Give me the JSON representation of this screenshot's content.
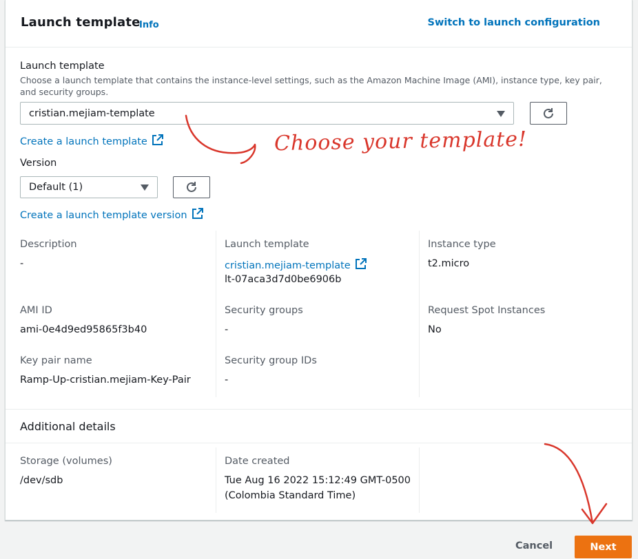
{
  "header": {
    "title": "Launch template",
    "info": "Info",
    "switch_link": "Switch to launch configuration"
  },
  "template_field": {
    "label": "Launch template",
    "description": "Choose a launch template that contains the instance-level settings, such as the Amazon Machine Image (AMI), instance type, key pair, and security groups.",
    "selected": "cristian.mejiam-template",
    "create_link": "Create a launch template"
  },
  "version_field": {
    "label": "Version",
    "selected": "Default (1)",
    "create_link": "Create a launch template version"
  },
  "details": {
    "description_label": "Description",
    "description_value": "-",
    "launch_template_label": "Launch template",
    "launch_template_link": "cristian.mejiam-template",
    "launch_template_id": "lt-07aca3d7d0be6906b",
    "instance_type_label": "Instance type",
    "instance_type_value": "t2.micro",
    "ami_label": "AMI ID",
    "ami_value": "ami-0e4d9ed95865f3b40",
    "security_groups_label": "Security groups",
    "security_groups_value": "-",
    "spot_label": "Request Spot Instances",
    "spot_value": "No",
    "key_pair_label": "Key pair name",
    "key_pair_value": "Ramp-Up-cristian.mejiam-Key-Pair",
    "sg_ids_label": "Security group IDs",
    "sg_ids_value": "-"
  },
  "additional": {
    "title": "Additional details",
    "storage_label": "Storage (volumes)",
    "storage_value": "/dev/sdb",
    "date_label": "Date created",
    "date_value_line1": "Tue Aug 16 2022 15:12:49 GMT-0500",
    "date_value_line2": "(Colombia Standard Time)"
  },
  "footer": {
    "cancel": "Cancel",
    "next": "Next"
  },
  "annotation": {
    "text": "Choose your template!",
    "color": "#d9362b"
  },
  "colors": {
    "link": "#0073bb",
    "primary_button": "#ec7211"
  }
}
